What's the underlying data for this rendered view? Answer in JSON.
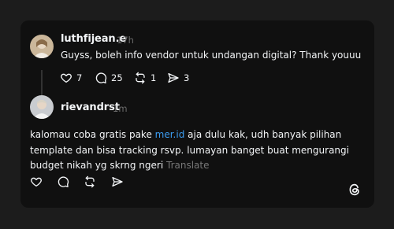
{
  "post": {
    "author": "luthfijean.e",
    "time": "17h",
    "text": "Guyss, boleh info vendor untuk undangan digital? Thank youuu",
    "likes": "7",
    "comments": "25",
    "reposts": "1",
    "shares": "3"
  },
  "reply": {
    "author": "rievandrst",
    "time": "1m",
    "text_before": "kalomau coba gratis pake ",
    "link": "mer.id",
    "text_after": " aja dulu kak, udh banyak pilihan template dan bisa tracking rsvp. lumayan banget buat mengurangi budget nikah yg skrng ngeri",
    "translate": "Translate"
  },
  "colors": {
    "background": "#1c1c1c",
    "card": "#101010",
    "link": "#3b9cf0",
    "muted": "#6b6b6b"
  },
  "icons": [
    "heart-icon",
    "comment-icon",
    "repost-icon",
    "share-icon",
    "threads-logo-icon"
  ]
}
